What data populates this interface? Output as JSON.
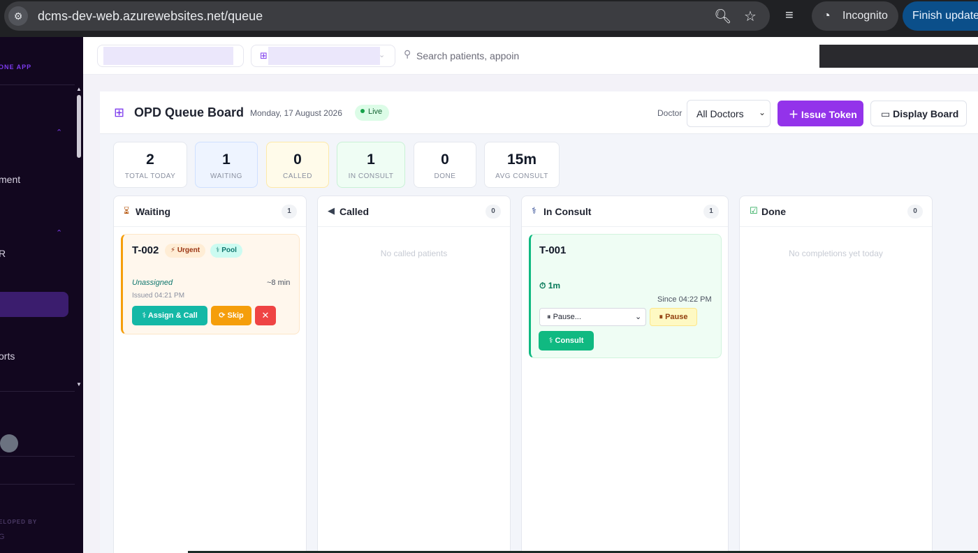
{
  "browser": {
    "url": "dcms-dev-web.azurewebsites.net/queue",
    "incognito_label": "Incognito",
    "finish_update_label": "Finish update"
  },
  "sidebar": {
    "brand_fragment": "ONE APP",
    "items": [
      "ment",
      "R",
      "orts"
    ],
    "developed_by": "ELOPED BY",
    "footer_fragment": "G"
  },
  "topbar": {
    "search_placeholder": "Search patients, appoin"
  },
  "header": {
    "title": "OPD Queue Board",
    "date": "Monday, 17 August 2026",
    "live_label": "Live",
    "doctor_label": "Doctor",
    "doctor_selected": "All Doctors",
    "issue_token_label": "Issue Token",
    "display_board_label": "Display Board"
  },
  "stats": [
    {
      "value": "2",
      "label": "TOTAL TODAY"
    },
    {
      "value": "1",
      "label": "WAITING"
    },
    {
      "value": "0",
      "label": "CALLED"
    },
    {
      "value": "1",
      "label": "IN CONSULT"
    },
    {
      "value": "0",
      "label": "DONE"
    },
    {
      "value": "15m",
      "label": "AVG CONSULT"
    }
  ],
  "columns": {
    "waiting": {
      "title": "Waiting",
      "count": "1",
      "card": {
        "token": "T-002",
        "badge_urgent": "Urgent",
        "badge_pool": "Pool",
        "assignee": "Unassigned",
        "eta": "~8 min",
        "issued": "Issued 04:21 PM",
        "assign_label": "Assign & Call",
        "skip_label": "Skip",
        "cancel_label": "✕"
      }
    },
    "called": {
      "title": "Called",
      "count": "0",
      "empty": "No called patients"
    },
    "consult": {
      "title": "In Consult",
      "count": "1",
      "card": {
        "token": "T-001",
        "timer": "1m",
        "since": "Since 04:22 PM",
        "pause_select": "Pause...",
        "pause_label": "Pause",
        "consult_label": "Consult"
      }
    },
    "done": {
      "title": "Done",
      "count": "0",
      "empty": "No completions yet today"
    }
  },
  "colors": {
    "accent": "#9333ea",
    "sidebar_bg": "#12071f",
    "waiting_border": "#f59e0b",
    "consult_border": "#10b981",
    "live_bg": "#dcfce7"
  },
  "icons": {
    "site_info": "tune-icon",
    "zoom": "zoom-icon",
    "bookmark": "star-icon",
    "media": "queue-music-icon",
    "queue_board": "add-box-icon",
    "waiting": "hourglass-icon",
    "called": "megaphone-icon",
    "consult": "stethoscope-icon",
    "done": "check-box-icon"
  }
}
